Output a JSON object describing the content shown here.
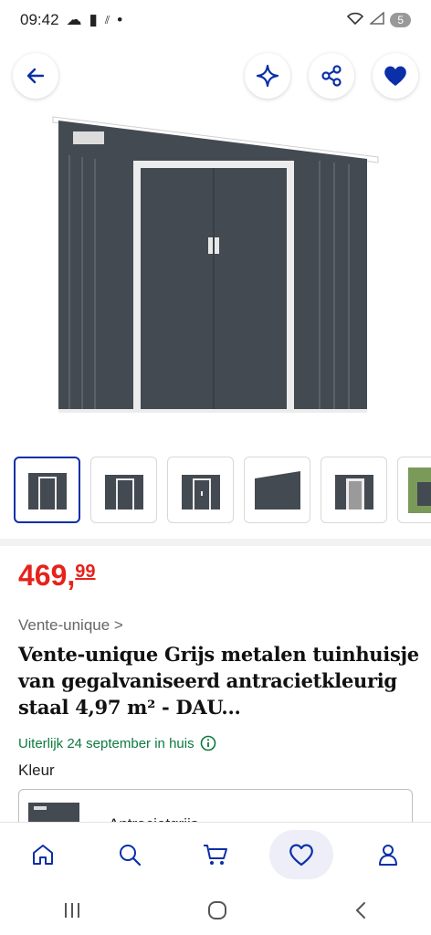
{
  "status": {
    "time": "09:42",
    "battery": "5"
  },
  "product": {
    "price_whole": "469,",
    "price_cents": "99",
    "brand_link": "Vente-unique >",
    "title": "Vente-unique Grijs metalen tuinhuisje van gegalvaniseerd antracietkleurig staal 4,97 m² - DAU...",
    "delivery": "Uiterlijk 24 september in huis",
    "color_label": "Kleur",
    "selected_color": "Antracietgrijs"
  },
  "colors": {
    "price": "#e6221b",
    "primary": "#0a2fa8",
    "delivery": "#0e7a3e",
    "shed": "#444a52"
  },
  "thumbnails": [
    "front-view",
    "front-view-2",
    "front-view-3",
    "side-view",
    "open-door",
    "garden-photo"
  ],
  "icons": {
    "back": "back-arrow-icon",
    "sparkle": "sparkle-icon",
    "share": "share-icon",
    "wishlist": "heart-icon",
    "nav": [
      "home-icon",
      "search-icon",
      "cart-icon",
      "heart-icon",
      "profile-icon"
    ]
  }
}
